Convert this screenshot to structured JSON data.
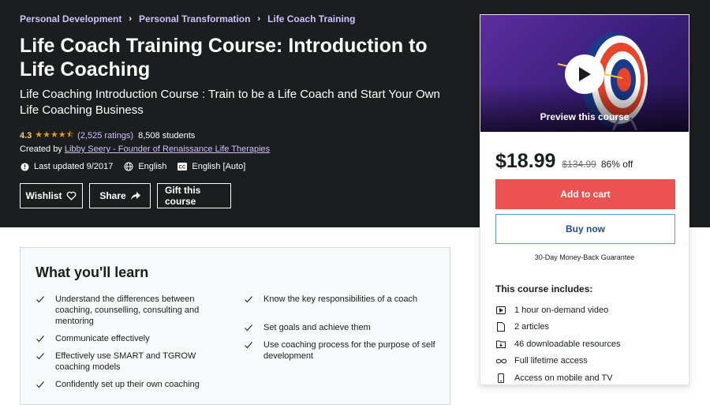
{
  "breadcrumbs": [
    "Personal Development",
    "Personal Transformation",
    "Life Coach Training"
  ],
  "title": "Life Coach Training Course: Introduction to Life Coaching",
  "subtitle": "Life Coaching Introduction Course : Train to be a Life Coach and Start Your Own Life Coaching Business",
  "rating": {
    "value": "4.3",
    "stars": "★★★★⯪",
    "count": "(2,525 ratings)",
    "students": "8,508 students"
  },
  "created": {
    "prefix": "Created by",
    "author": "Libby Seery - Founder of Renaissance Life Therapies"
  },
  "meta": {
    "updated": "Last updated 9/2017",
    "language": "English",
    "captions": "English [Auto]"
  },
  "buttons": {
    "wishlist": "Wishlist",
    "share": "Share",
    "gift": "Gift this course"
  },
  "sidebar": {
    "preview_label": "Preview this course",
    "price": "$18.99",
    "original_price": "$134.99",
    "discount": "86% off",
    "add_to_cart": "Add to cart",
    "buy_now": "Buy now",
    "guarantee": "30-Day Money-Back Guarantee",
    "includes_title": "This course includes:",
    "includes": [
      {
        "icon": "video-icon",
        "label": "1 hour on-demand video"
      },
      {
        "icon": "file-icon",
        "label": "2 articles"
      },
      {
        "icon": "folder-icon",
        "label": "46 downloadable resources"
      },
      {
        "icon": "infinity-icon",
        "label": "Full lifetime access"
      },
      {
        "icon": "mobile-icon",
        "label": "Access on mobile and TV"
      }
    ]
  },
  "learn": {
    "heading": "What you'll learn",
    "left": [
      "Understand the differences between coaching, counselling, consulting and mentoring",
      "Communicate effectively",
      "Effectively use SMART and TGROW coaching models",
      "Confidently set up their own coaching"
    ],
    "right": [
      "Know the key responsibilities of a coach",
      "Set goals and achieve them",
      "Use coaching process for the purpose of self development"
    ]
  },
  "colors": {
    "hero_bg": "#1c1d1f",
    "link_purple": "#cec0fc",
    "star": "#e59819",
    "cart_red": "#ec5252"
  }
}
